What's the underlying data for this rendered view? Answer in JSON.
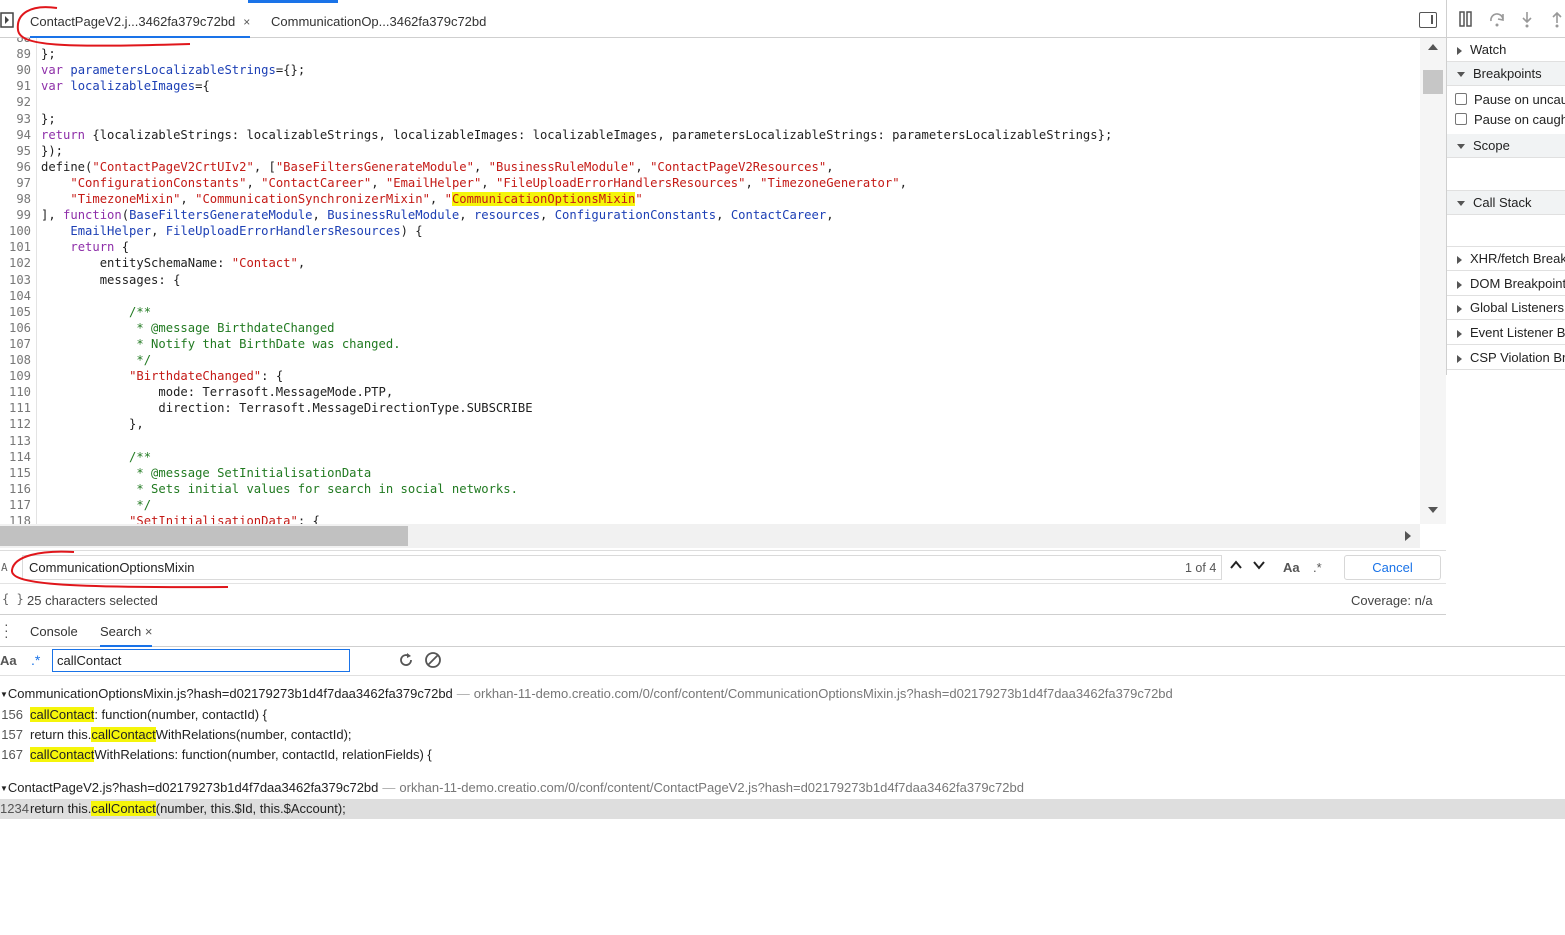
{
  "editor_tabs": [
    {
      "label": "ContactPageV2.j...3462fa379c72bd",
      "active": true,
      "close": "×"
    },
    {
      "label": "CommunicationOp...3462fa379c72bd",
      "active": false
    }
  ],
  "code_lines": [
    {
      "n": "88",
      "parts": [
        {
          "t": "",
          "c": ""
        }
      ]
    },
    {
      "n": "89",
      "parts": [
        {
          "t": "};",
          "c": ""
        }
      ]
    },
    {
      "n": "90",
      "parts": [
        {
          "t": "var ",
          "c": "kw"
        },
        {
          "t": "parametersLocalizableStrings",
          "c": "vr"
        },
        {
          "t": "={};",
          "c": ""
        }
      ]
    },
    {
      "n": "91",
      "parts": [
        {
          "t": "var ",
          "c": "kw"
        },
        {
          "t": "localizableImages",
          "c": "vr"
        },
        {
          "t": "={",
          "c": ""
        }
      ]
    },
    {
      "n": "92",
      "parts": [
        {
          "t": "",
          "c": ""
        }
      ]
    },
    {
      "n": "93",
      "parts": [
        {
          "t": "};",
          "c": ""
        }
      ]
    },
    {
      "n": "94",
      "parts": [
        {
          "t": "return ",
          "c": "kw"
        },
        {
          "t": "{localizableStrings: localizableStrings, localizableImages: localizableImages, parametersLocalizableStrings: parametersLocalizableStrings};",
          "c": ""
        }
      ]
    },
    {
      "n": "95",
      "parts": [
        {
          "t": "});",
          "c": ""
        }
      ]
    },
    {
      "n": "96",
      "parts": [
        {
          "t": "define(",
          "c": ""
        },
        {
          "t": "\"ContactPageV2CrtUIv2\"",
          "c": "str"
        },
        {
          "t": ", [",
          "c": ""
        },
        {
          "t": "\"BaseFiltersGenerateModule\"",
          "c": "str"
        },
        {
          "t": ", ",
          "c": ""
        },
        {
          "t": "\"BusinessRuleModule\"",
          "c": "str"
        },
        {
          "t": ", ",
          "c": ""
        },
        {
          "t": "\"ContactPageV2Resources\"",
          "c": "str"
        },
        {
          "t": ",",
          "c": ""
        }
      ]
    },
    {
      "n": "97",
      "parts": [
        {
          "t": "    ",
          "c": ""
        },
        {
          "t": "\"ConfigurationConstants\"",
          "c": "str"
        },
        {
          "t": ", ",
          "c": ""
        },
        {
          "t": "\"ContactCareer\"",
          "c": "str"
        },
        {
          "t": ", ",
          "c": ""
        },
        {
          "t": "\"EmailHelper\"",
          "c": "str"
        },
        {
          "t": ", ",
          "c": ""
        },
        {
          "t": "\"FileUploadErrorHandlersResources\"",
          "c": "str"
        },
        {
          "t": ", ",
          "c": ""
        },
        {
          "t": "\"TimezoneGenerator\"",
          "c": "str"
        },
        {
          "t": ",",
          "c": ""
        }
      ]
    },
    {
      "n": "98",
      "parts": [
        {
          "t": "    ",
          "c": ""
        },
        {
          "t": "\"TimezoneMixin\"",
          "c": "str"
        },
        {
          "t": ", ",
          "c": ""
        },
        {
          "t": "\"CommunicationSynchronizerMixin\"",
          "c": "str"
        },
        {
          "t": ", ",
          "c": ""
        },
        {
          "t": "\"",
          "c": "str"
        },
        {
          "t": "CommunicationOptionsMixin",
          "c": "hl"
        },
        {
          "t": "\"",
          "c": "str"
        }
      ]
    },
    {
      "n": "99",
      "parts": [
        {
          "t": "], ",
          "c": ""
        },
        {
          "t": "function",
          "c": "kw"
        },
        {
          "t": "(",
          "c": ""
        },
        {
          "t": "BaseFiltersGenerateModule",
          "c": "vr"
        },
        {
          "t": ", ",
          "c": ""
        },
        {
          "t": "BusinessRuleModule",
          "c": "vr"
        },
        {
          "t": ", ",
          "c": ""
        },
        {
          "t": "resources",
          "c": "vr"
        },
        {
          "t": ", ",
          "c": ""
        },
        {
          "t": "ConfigurationConstants",
          "c": "vr"
        },
        {
          "t": ", ",
          "c": ""
        },
        {
          "t": "ContactCareer",
          "c": "vr"
        },
        {
          "t": ",",
          "c": ""
        }
      ]
    },
    {
      "n": "100",
      "parts": [
        {
          "t": "    ",
          "c": ""
        },
        {
          "t": "EmailHelper",
          "c": "vr"
        },
        {
          "t": ", ",
          "c": ""
        },
        {
          "t": "FileUploadErrorHandlersResources",
          "c": "vr"
        },
        {
          "t": ") {",
          "c": ""
        }
      ]
    },
    {
      "n": "101",
      "parts": [
        {
          "t": "    ",
          "c": ""
        },
        {
          "t": "return",
          "c": "kw"
        },
        {
          "t": " {",
          "c": ""
        }
      ]
    },
    {
      "n": "102",
      "parts": [
        {
          "t": "        entitySchemaName: ",
          "c": ""
        },
        {
          "t": "\"Contact\"",
          "c": "str"
        },
        {
          "t": ",",
          "c": ""
        }
      ]
    },
    {
      "n": "103",
      "parts": [
        {
          "t": "        messages: {",
          "c": ""
        }
      ]
    },
    {
      "n": "104",
      "parts": [
        {
          "t": "",
          "c": ""
        }
      ]
    },
    {
      "n": "105",
      "parts": [
        {
          "t": "            /**",
          "c": "cm"
        }
      ]
    },
    {
      "n": "106",
      "parts": [
        {
          "t": "             * @message BirthdateChanged",
          "c": "cm"
        }
      ]
    },
    {
      "n": "107",
      "parts": [
        {
          "t": "             * Notify that BirthDate was changed.",
          "c": "cm"
        }
      ]
    },
    {
      "n": "108",
      "parts": [
        {
          "t": "             */",
          "c": "cm"
        }
      ]
    },
    {
      "n": "109",
      "parts": [
        {
          "t": "            ",
          "c": ""
        },
        {
          "t": "\"BirthdateChanged\"",
          "c": "str"
        },
        {
          "t": ": {",
          "c": ""
        }
      ]
    },
    {
      "n": "110",
      "parts": [
        {
          "t": "                mode: Terrasoft.MessageMode.PTP,",
          "c": ""
        }
      ]
    },
    {
      "n": "111",
      "parts": [
        {
          "t": "                direction: Terrasoft.MessageDirectionType.SUBSCRIBE",
          "c": ""
        }
      ]
    },
    {
      "n": "112",
      "parts": [
        {
          "t": "            },",
          "c": ""
        }
      ]
    },
    {
      "n": "113",
      "parts": [
        {
          "t": "",
          "c": ""
        }
      ]
    },
    {
      "n": "114",
      "parts": [
        {
          "t": "            /**",
          "c": "cm"
        }
      ]
    },
    {
      "n": "115",
      "parts": [
        {
          "t": "             * @message SetInitialisationData",
          "c": "cm"
        }
      ]
    },
    {
      "n": "116",
      "parts": [
        {
          "t": "             * Sets initial values for search in social networks.",
          "c": "cm"
        }
      ]
    },
    {
      "n": "117",
      "parts": [
        {
          "t": "             */",
          "c": "cm"
        }
      ]
    },
    {
      "n": "118",
      "parts": [
        {
          "t": "            ",
          "c": ""
        },
        {
          "t": "\"SetInitialisationData\"",
          "c": "str"
        },
        {
          "t": ": {",
          "c": ""
        }
      ]
    }
  ],
  "find": {
    "query": "CommunicationOptionsMixin",
    "count": "1 of 4",
    "up": "⌃",
    "down": "⌄",
    "match_case": "Aa",
    "regex": ".*",
    "cancel": "Cancel"
  },
  "status": {
    "braces": "{ }",
    "selection": "25 characters selected",
    "coverage": "Coverage: n/a"
  },
  "sidebar": {
    "panes": [
      {
        "label": "Watch",
        "open": false
      },
      {
        "label": "Breakpoints",
        "open": true
      },
      {
        "label": "Scope",
        "open": true
      },
      {
        "label": "Call Stack",
        "open": true
      },
      {
        "label": "XHR/fetch Breakpoints",
        "open": false
      },
      {
        "label": "DOM Breakpoints",
        "open": false
      },
      {
        "label": "Global Listeners",
        "open": false
      },
      {
        "label": "Event Listener Breakpoints",
        "open": false
      },
      {
        "label": "CSP Violation Breakpoints",
        "open": false
      }
    ],
    "checkboxes": [
      "Pause on uncaught exceptions",
      "Pause on caught exceptions"
    ]
  },
  "drawer": {
    "tabs": [
      {
        "label": "Console"
      },
      {
        "label": "Search"
      }
    ],
    "close": "×",
    "search_query": "callContact",
    "match_case": "Aa",
    "regex": ".*"
  },
  "results": [
    {
      "file": "CommunicationOptionsMixin.js?hash=d02179273b1d4f7daa3462fa379c72bd",
      "url": "orkhan-11-demo.creatio.com/0/conf/content/CommunicationOptionsMixin.js?hash=d02179273b1d4f7daa3462fa379c72bd",
      "lines": [
        {
          "n": "156",
          "pre": "",
          "match": "callContact",
          "post": ": function(number, contactId) {"
        },
        {
          "n": "157",
          "pre": "return this.",
          "match": "callContact",
          "post": "WithRelations(number, contactId);"
        },
        {
          "n": "167",
          "pre": "",
          "match": "callContact",
          "post": "WithRelations: function(number, contactId, relationFields) {"
        }
      ]
    },
    {
      "file": "ContactPageV2.js?hash=d02179273b1d4f7daa3462fa379c72bd",
      "url": "orkhan-11-demo.creatio.com/0/conf/content/ContactPageV2.js?hash=d02179273b1d4f7daa3462fa379c72bd",
      "lines": [
        {
          "n": "1234",
          "pre": "return this.",
          "match": "callContact",
          "post": "(number, this.$Id, this.$Account);"
        }
      ]
    }
  ],
  "colors": {
    "accent": "#1a73e8",
    "highlight": "#f5f50a",
    "annotation": "#e0161b"
  }
}
